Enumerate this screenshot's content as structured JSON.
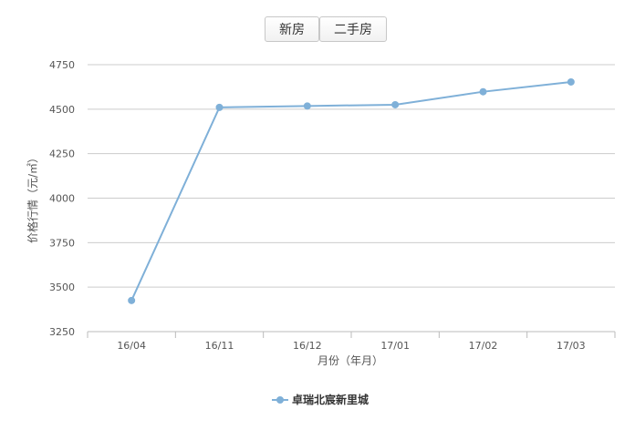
{
  "tabs": [
    {
      "label": "新房"
    },
    {
      "label": "二手房"
    }
  ],
  "chart_data": {
    "type": "line",
    "categories": [
      "16/04",
      "16/11",
      "16/12",
      "17/01",
      "17/02",
      "17/03"
    ],
    "series": [
      {
        "name": "卓瑞北宸新里城",
        "values": [
          3425,
          4510,
          4518,
          4525,
          4598,
          4653
        ],
        "color": "#7fb0d8"
      }
    ],
    "xlabel": "月份（年月）",
    "ylabel": "价格行情（元/㎡）",
    "ylim": [
      3250,
      4750
    ],
    "yticks": [
      3250,
      3500,
      3750,
      4000,
      4250,
      4500,
      4750
    ],
    "grid": true,
    "legend": "bottom-center"
  }
}
